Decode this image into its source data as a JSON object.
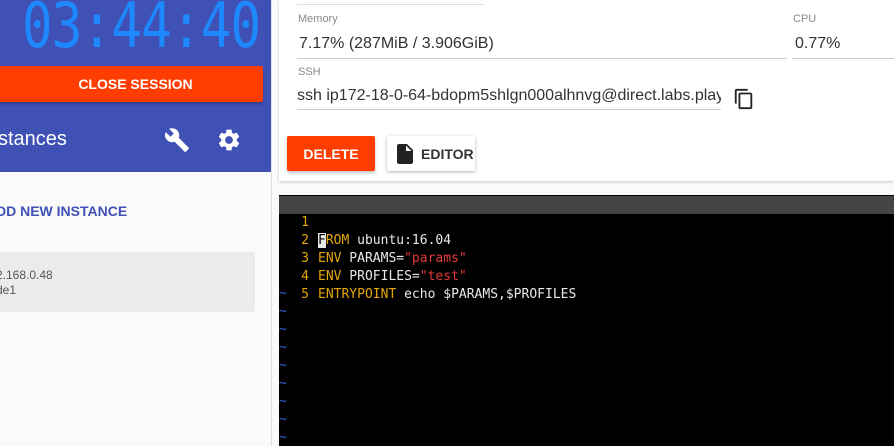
{
  "sidebar": {
    "timer": "03:44:40",
    "close_session_label": "CLOSE SESSION",
    "instances_title": "stances",
    "add_instance_label": "DD NEW INSTANCE",
    "instance": {
      "ip": "2.168.0.48",
      "name": "de1"
    }
  },
  "details": {
    "memory_label": "Memory",
    "memory_value": "7.17% (287MiB / 3.906GiB)",
    "cpu_label": "CPU",
    "cpu_value": "0.77%",
    "ssh_label": "SSH",
    "ssh_value": "ssh ip172-18-0-64-bdopm5shlgn000alhnvg@direct.labs.play",
    "delete_label": "DELETE",
    "editor_label": "EDITOR"
  },
  "terminal": {
    "lines": [
      {
        "num": "1",
        "cursor_char": "F",
        "kw": "ROM",
        "rest": " ubuntu:16.04"
      },
      {
        "num": "2",
        "kw": "ENV",
        "plain": " PARAMS=",
        "str": "\"params\""
      },
      {
        "num": "3",
        "kw": "ENV",
        "plain": " PROFILES=",
        "str": "\"test\""
      },
      {
        "num": "4",
        "kw": "ENTRYPOINT",
        "plain": " echo $PARAMS,$PROFILES"
      },
      {
        "num": "5"
      }
    ],
    "tilde": "~"
  },
  "colors": {
    "sidebar_header": "#3f51b5",
    "timer": "#1e88ff",
    "danger_button": "#ff3d00",
    "keyword": "#e5a50a",
    "string": "#e53935",
    "tilde": "#3465d4"
  }
}
